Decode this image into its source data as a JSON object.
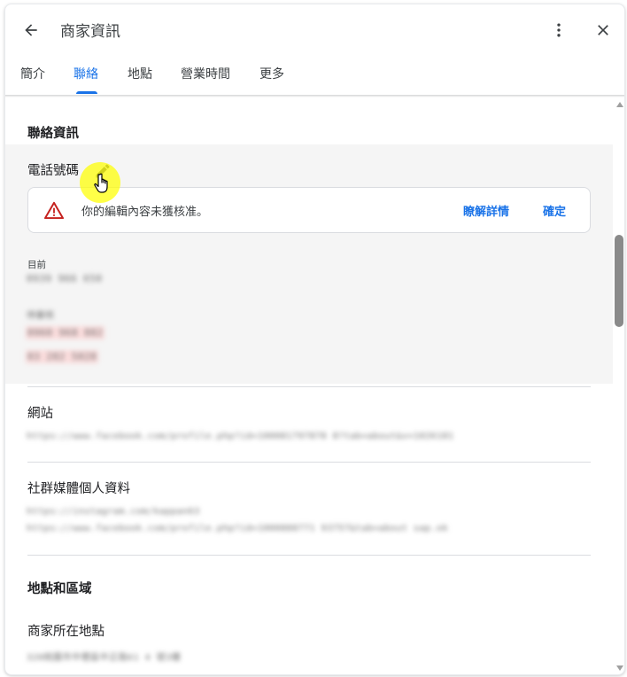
{
  "header": {
    "title": "商家資訊",
    "back_icon": "arrow-back-icon",
    "more_icon": "more-vert-icon",
    "close_icon": "close-icon"
  },
  "tabs": [
    {
      "label": "簡介",
      "active": false
    },
    {
      "label": "聯絡",
      "active": true
    },
    {
      "label": "地點",
      "active": false
    },
    {
      "label": "營業時間",
      "active": false
    },
    {
      "label": "更多",
      "active": false
    }
  ],
  "contact": {
    "heading": "聯絡資訊",
    "phone": {
      "label": "電話號碼",
      "edit_icon": "pencil-icon",
      "alert": {
        "icon": "warning-icon",
        "message": "你的編輯內容未獲核准。",
        "learn_more": "瞭解詳情",
        "confirm": "確定"
      },
      "current_label": "目前",
      "current_value": "0939 966 650",
      "pending_label": "待審核",
      "pending_values": [
        "0960 968 882",
        "03 282 5028"
      ]
    },
    "website": {
      "label": "網站",
      "value": "https://www.facebook.com/profile.php?id=100081797878 8?tab=about&v=1026181"
    },
    "social": {
      "label": "社群媒體個人資料",
      "values": [
        "https://instagram.com/kappan63",
        "https://www.facebook.com/profile.php?id=1000888771 93757&tab=about sap.ok"
      ]
    }
  },
  "location": {
    "heading": "地點和區域",
    "address_label": "商家所在地點",
    "address_value": "320桃園市中壢區中正路61 4 號3樓"
  },
  "colors": {
    "accent": "#1a73e8",
    "warning": "#c5221f",
    "highlight": "#ffff00"
  }
}
